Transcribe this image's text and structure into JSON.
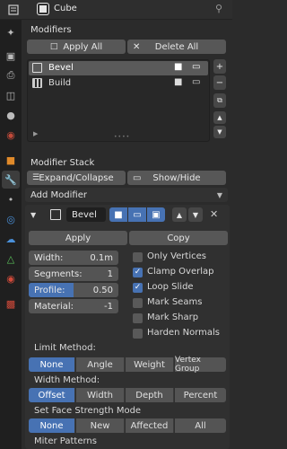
{
  "header": {
    "object_name": "Cube"
  },
  "modifiers_panel": {
    "title": "Modifiers",
    "apply_all_label": "Apply All",
    "delete_all_label": "Delete All",
    "list": [
      {
        "name": "Bevel",
        "selected": true
      },
      {
        "name": "Build",
        "selected": false
      }
    ]
  },
  "modifier_stack": {
    "title": "Modifier Stack",
    "expand_collapse_label": "Expand/Collapse",
    "show_hide_label": "Show/Hide"
  },
  "add_modifier_label": "Add Modifier",
  "bevel": {
    "name": "Bevel",
    "apply_label": "Apply",
    "copy_label": "Copy",
    "width_label": "Width:",
    "width_value": "0.1m",
    "segments_label": "Segments:",
    "segments_value": "1",
    "profile_label": "Profile:",
    "profile_value": "0.50",
    "material_label": "Material:",
    "material_value": "-1",
    "options": [
      {
        "label": "Only Vertices",
        "checked": false
      },
      {
        "label": "Clamp Overlap",
        "checked": true
      },
      {
        "label": "Loop Slide",
        "checked": true
      },
      {
        "label": "Mark Seams",
        "checked": false
      },
      {
        "label": "Mark Sharp",
        "checked": false
      },
      {
        "label": "Harden Normals",
        "checked": false
      }
    ],
    "limit_method_label": "Limit Method:",
    "limit_method_options": [
      "None",
      "Angle",
      "Weight",
      "Vertex Group"
    ],
    "limit_method_selected": "None",
    "width_method_label": "Width Method:",
    "width_method_options": [
      "Offset",
      "Width",
      "Depth",
      "Percent"
    ],
    "width_method_selected": "Offset",
    "face_strength_label": "Set Face Strength Mode",
    "face_strength_options": [
      "None",
      "New",
      "Affected",
      "All"
    ],
    "face_strength_selected": "None",
    "miter_patterns_label": "Miter Patterns"
  },
  "colors": {
    "accent": "#4772b3",
    "bg": "#2b2b2b",
    "button": "#575757"
  }
}
